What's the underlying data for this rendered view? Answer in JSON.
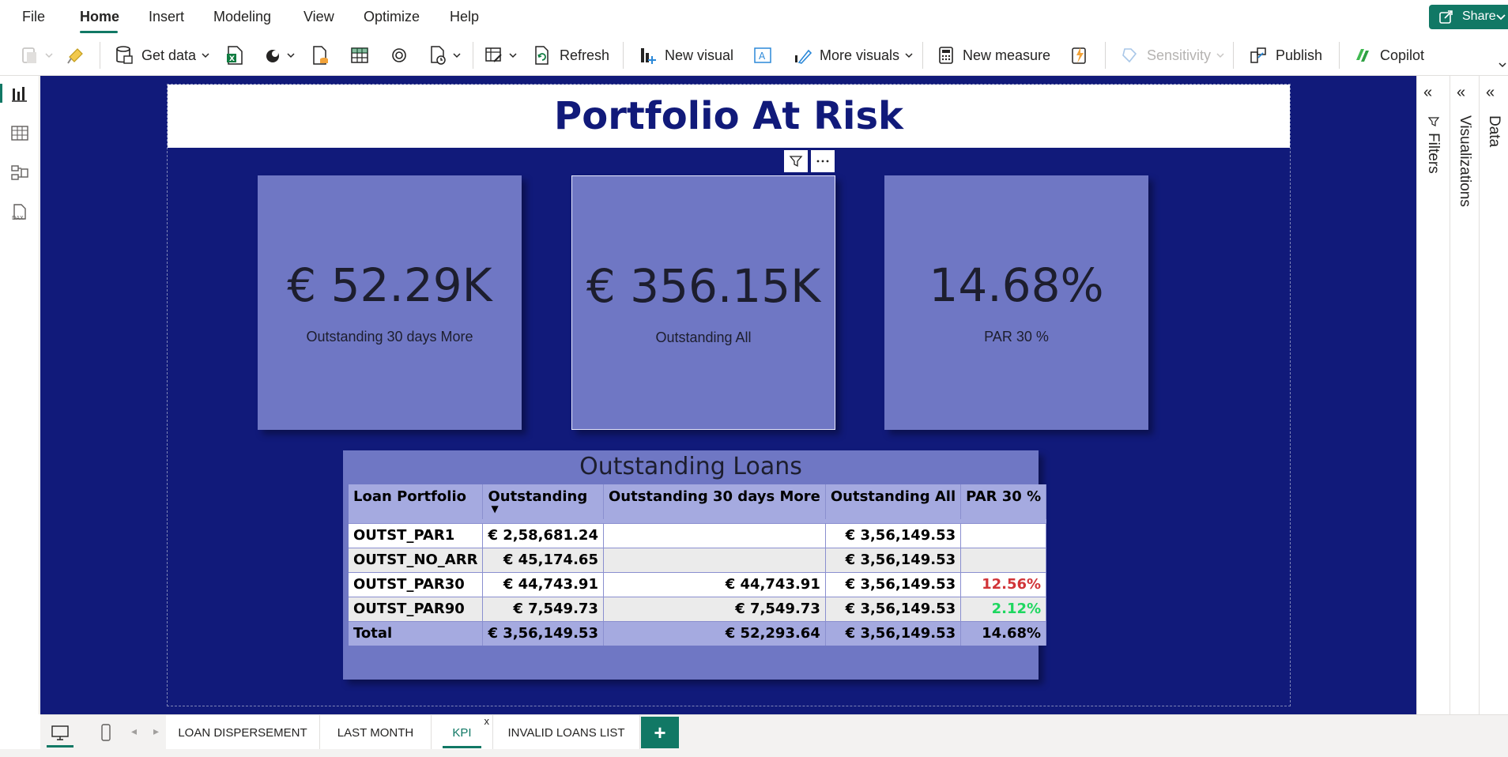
{
  "menu": {
    "items": [
      "File",
      "Home",
      "Insert",
      "Modeling",
      "View",
      "Optimize",
      "Help"
    ],
    "active": "Home",
    "share_label": "Share"
  },
  "ribbon": {
    "get_data": "Get data",
    "refresh": "Refresh",
    "new_visual": "New visual",
    "more_visuals": "More visuals",
    "new_measure": "New measure",
    "sensitivity": "Sensitivity",
    "publish": "Publish",
    "copilot": "Copilot"
  },
  "report": {
    "title": "Portfolio At Risk",
    "cards": [
      {
        "value": "€ 52.29K",
        "caption": "Outstanding 30 days More"
      },
      {
        "value": "€ 356.15K",
        "caption": "Outstanding All"
      },
      {
        "value": "14.68%",
        "caption": "PAR 30 %"
      }
    ],
    "table": {
      "title": "Outstanding Loans",
      "columns": [
        "Loan Portfolio",
        "Outstanding",
        "Outstanding 30 days More",
        "Outstanding All",
        "PAR 30 %"
      ],
      "rows": [
        [
          "OUTST_PAR1",
          "€ 2,58,681.24",
          "",
          "€ 3,56,149.53",
          ""
        ],
        [
          "OUTST_NO_ARR",
          "€ 45,174.65",
          "",
          "€ 3,56,149.53",
          ""
        ],
        [
          "OUTST_PAR30",
          "€ 44,743.91",
          "€ 44,743.91",
          "€ 3,56,149.53",
          "12.56%"
        ],
        [
          "OUTST_PAR90",
          "€ 7,549.73",
          "€ 7,549.73",
          "€ 3,56,149.53",
          "2.12%"
        ]
      ],
      "total": [
        "Total",
        "€ 3,56,149.53",
        "€ 52,293.64",
        "€ 3,56,149.53",
        "14.68%"
      ],
      "colors": {
        "high_par": "#d13438",
        "low_par": "#1ed760"
      }
    }
  },
  "panes": {
    "filters": "Filters",
    "visualizations": "Visualizations",
    "data": "Data"
  },
  "tabs": {
    "pages": [
      "LOAN DISPERSEMENT",
      "LAST MONTH",
      "KPI",
      "INVALID LOANS LIST"
    ],
    "active": "KPI",
    "close_glyph": "x",
    "add_glyph": "+"
  },
  "theme": {
    "canvas_bg": "#111a7a",
    "card_bg": "#6f77c4",
    "accent": "#117865"
  }
}
